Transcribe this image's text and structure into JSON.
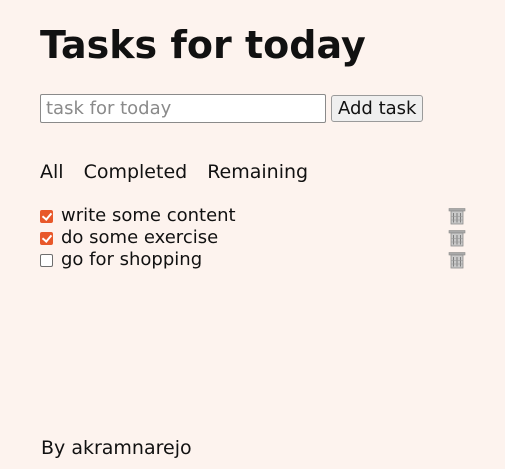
{
  "page": {
    "title": "Tasks for today"
  },
  "add_form": {
    "placeholder": "task for today",
    "value": "",
    "button_label": "Add task"
  },
  "filters": [
    {
      "label": "All"
    },
    {
      "label": "Completed"
    },
    {
      "label": "Remaining"
    }
  ],
  "tasks": [
    {
      "text": "write some content",
      "completed": true
    },
    {
      "text": "do some exercise",
      "completed": true
    },
    {
      "text": "go for shopping",
      "completed": false
    }
  ],
  "footer": {
    "text": "By akramnarejo"
  },
  "colors": {
    "background": "#fdf3ee",
    "checkbox_accent": "#e8582a"
  },
  "icons": {
    "delete": "trash-icon"
  }
}
